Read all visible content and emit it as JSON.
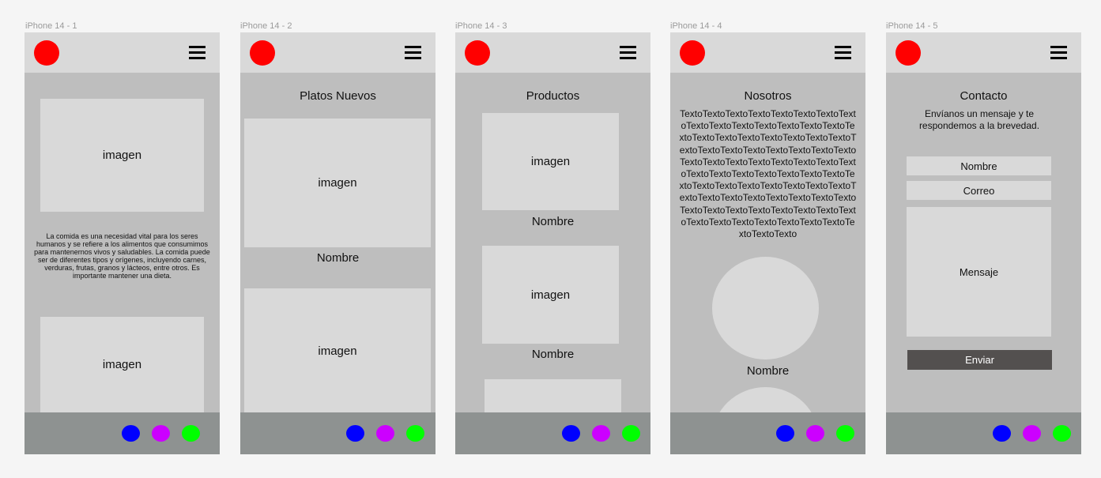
{
  "frames": [
    {
      "label": "iPhone 14 - 1"
    },
    {
      "label": "iPhone 14 - 2"
    },
    {
      "label": "iPhone 14 - 3"
    },
    {
      "label": "iPhone 14 - 4"
    },
    {
      "label": "iPhone 14 - 5"
    }
  ],
  "screen1": {
    "image1": "imagen",
    "paragraph": "La comida es una necesidad vital para los seres humanos y se refiere a los alimentos que consumimos para mantenernos vivos y saludables. La comida puede ser de diferentes tipos y orígenes, incluyendo carnes, verduras, frutas, granos y lácteos, entre otros. Es importante mantener una dieta.",
    "image2": "imagen"
  },
  "screen2": {
    "title": "Platos Nuevos",
    "image1": "imagen",
    "name1": "Nombre",
    "image2": "imagen"
  },
  "screen3": {
    "title": "Productos",
    "image1": "imagen",
    "name1": "Nombre",
    "image2": "imagen",
    "name2": "Nombre"
  },
  "screen4": {
    "title": "Nosotros",
    "body": "TextoTextoTextoTextoTextoTextoTextoTextoTextoTextoTextoTextoTextoTextoTextoTextoTextoTextoTextoTextoTextoTextoTextoTextoTextoTextoTextoTextoTextoTextoTextoTextoTextoTextoTextoTextoTextoTextoTextoTextoTextoTextoTextoTextoTextoTextoTextoTextoTextoTextoTextoTextoTextoTextoTextoTextoTextoTextoTextoTextoTextoTextoTextoTextoTextoTextoTextoTextoTextoTextoTextoTextoTextoTextoTextoTextoTextoTextoTextoTexto",
    "name1": "Nombre"
  },
  "screen5": {
    "title": "Contacto",
    "subtitle": "Envíanos un mensaje y te respondemos a la brevedad.",
    "name_placeholder": "Nombre",
    "email_placeholder": "Correo",
    "message_placeholder": "Mensaje",
    "send_label": "Enviar"
  },
  "colors": {
    "logo": "#ff0000",
    "footer_dot_1": "#0000ff",
    "footer_dot_2": "#cc00ff",
    "footer_dot_3": "#00ff00",
    "send_button": "#53504f"
  },
  "icons": {
    "header_logo": "red-circle-logo",
    "menu": "hamburger-menu-icon"
  }
}
